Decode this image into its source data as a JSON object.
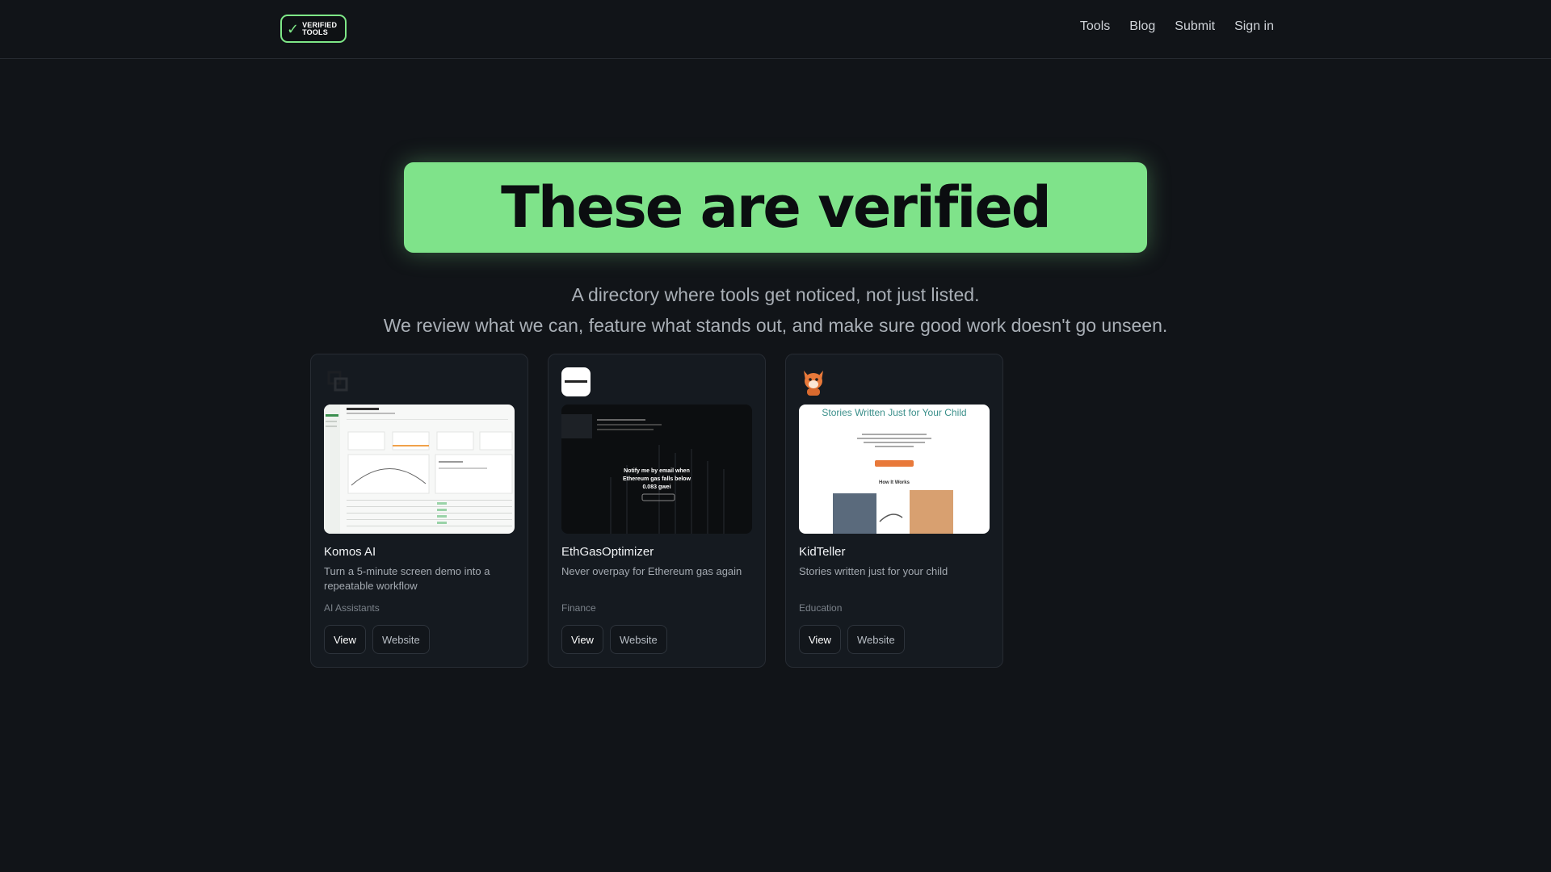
{
  "header": {
    "logo_line1": "VERIFIED",
    "logo_line2": "TOOLS",
    "nav": [
      {
        "label": "Tools"
      },
      {
        "label": "Blog"
      },
      {
        "label": "Submit"
      },
      {
        "label": "Sign in"
      }
    ]
  },
  "hero": {
    "title": "These are verified",
    "subtitle_1": "A directory where tools get noticed, not just listed.",
    "subtitle_2": "We review what we can, feature what stands out, and make sure good work doesn't go unseen."
  },
  "cards": [
    {
      "name": "Komos AI",
      "description": "Turn a 5-minute screen demo into a repeatable workflow",
      "category": "AI Assistants",
      "view_label": "View",
      "website_label": "Website",
      "icon": "komos-logo-icon"
    },
    {
      "name": "EthGasOptimizer",
      "description": "Never overpay for Ethereum gas again",
      "category": "Finance",
      "view_label": "View",
      "website_label": "Website",
      "icon": "ethgas-logo-icon",
      "shot_text_1": "Notify me by",
      "shot_text_2": "email when",
      "shot_text_3": "Ethereum gas falls below",
      "shot_text_4": "0.083",
      "shot_text_5": "gwei"
    },
    {
      "name": "KidTeller",
      "description": "Stories written just for your child",
      "category": "Education",
      "view_label": "View",
      "website_label": "Website",
      "icon": "fox-logo-icon",
      "shot_title": "Stories Written Just for Your Child",
      "shot_section": "How It Works"
    }
  ],
  "colors": {
    "background": "#111418",
    "accent": "#7fe38a",
    "card_bg": "#151a20"
  }
}
